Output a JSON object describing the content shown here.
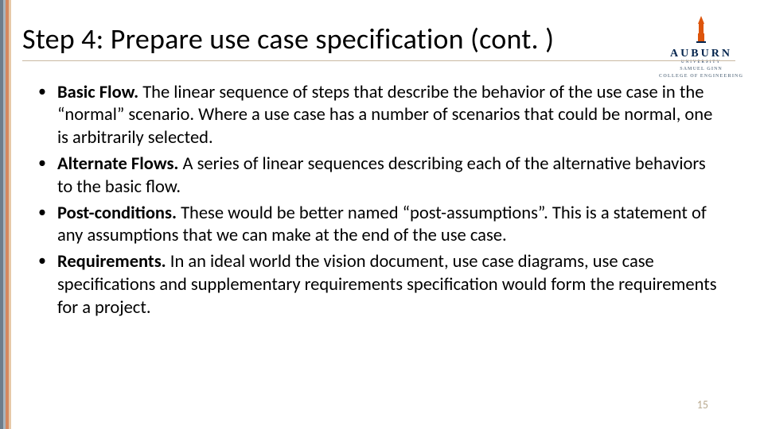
{
  "colors": {
    "stripe1": "#6e7d8b",
    "stripe2": "#a9b4bd",
    "stripe3": "#d5885f",
    "stripe4": "#e7c9a8",
    "rule": "#c9b9a2",
    "page_num": "#b9aa90",
    "logo_navy": "#03244d",
    "logo_orange": "#dd550c"
  },
  "logo": {
    "name": "AUBURN",
    "sub": "UNIVERSITY",
    "college_line1": "SAMUEL GINN",
    "college_line2": "COLLEGE OF ENGINEERING"
  },
  "title": "Step 4: Prepare use case specification (cont. )",
  "bullets": [
    {
      "term": "Basic Flow.",
      "body": " The linear sequence of steps that describe the behavior of the use case in the “normal” scenario. Where a use case has a number of scenarios that could be normal, one is arbitrarily selected."
    },
    {
      "term": "Alternate Flows.",
      "body": " A series of linear sequences describing each of the alternative behaviors to the basic flow."
    },
    {
      "term": "Post-conditions.",
      "body": " These would be better named “post-assumptions”. This is a statement of any assumptions that we can make at the end of the use case."
    },
    {
      "term": "Requirements.",
      "body": " In an ideal world the vision document, use case diagrams, use case specifications and supplementary requirements specification would form the requirements for a project."
    }
  ],
  "page_number": "15"
}
